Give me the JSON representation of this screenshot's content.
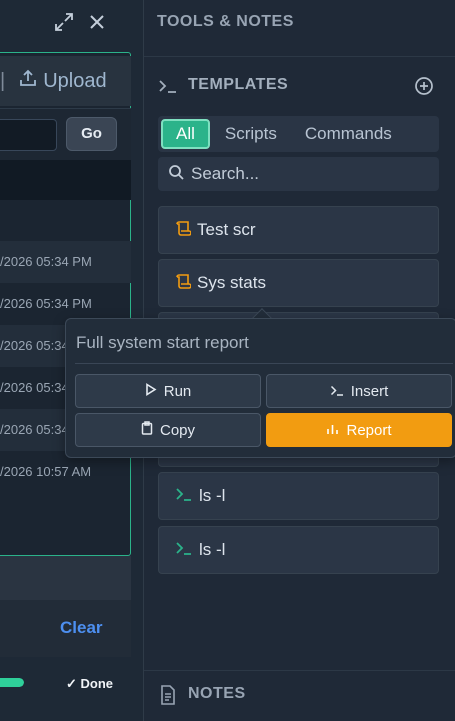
{
  "left_panel": {
    "upload_label": "Upload",
    "go_label": "Go",
    "history": [
      "/2026 05:34 PM",
      "/2026 05:34 PM",
      "/2026 05:34",
      "/2026 05:34",
      "/2026 05:34",
      "/2026 10:57 AM"
    ],
    "clear_label": "Clear",
    "done_label": "✓ Done",
    "progress_fraction": 1.0
  },
  "right_panel": {
    "section_title": "TOOLS & NOTES",
    "templates_title": "TEMPLATES",
    "filters": [
      "All",
      "Scripts",
      "Commands"
    ],
    "active_filter": "All",
    "search_placeholder": "Search...",
    "items": [
      {
        "icon": "scroll-icon",
        "label": "Test scr"
      },
      {
        "icon": "scroll-icon",
        "label": "Sys stats"
      },
      {
        "icon": "terminal-prompt-icon",
        "label": "ls -l"
      },
      {
        "icon": "terminal-prompt-icon",
        "label": "ls -l"
      }
    ],
    "notes_title": "NOTES"
  },
  "popover": {
    "title": "Full system start report",
    "run_label": "Run",
    "insert_label": "Insert",
    "copy_label": "Copy",
    "report_label": "Report"
  },
  "colors": {
    "accent_green": "#2bb38a",
    "script_icon": "#f29c11",
    "command_icon": "#2bb38a",
    "report_button": "#f29c11",
    "clear_link": "#4d8ff0"
  }
}
